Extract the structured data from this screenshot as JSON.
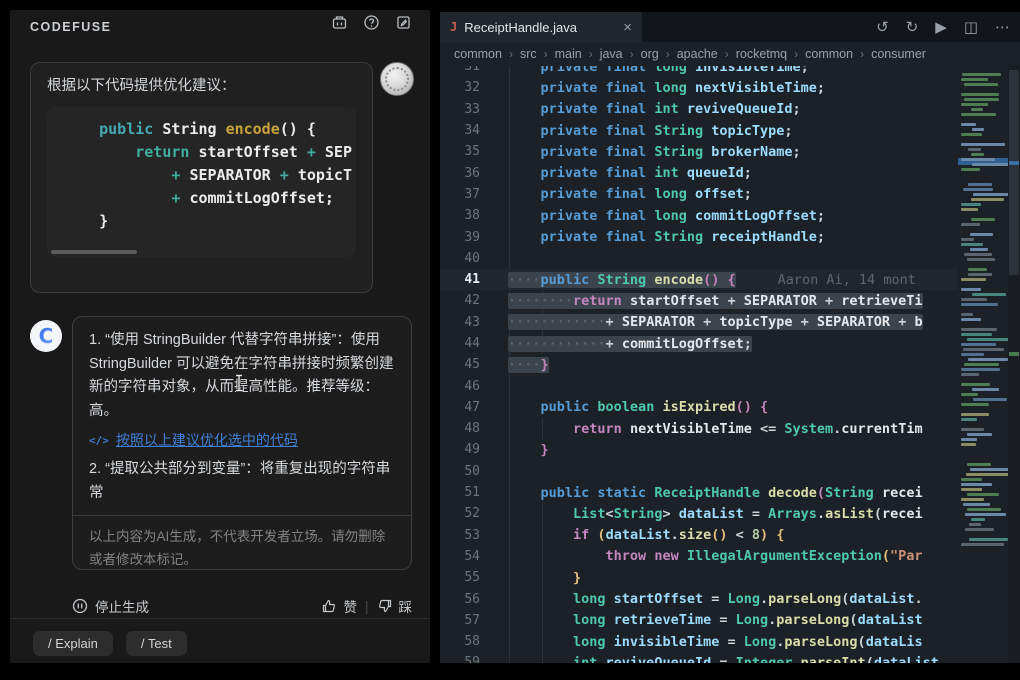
{
  "app": {
    "panel_title": "CODEFUSE"
  },
  "colors": {
    "panel_bg": "#191919",
    "editor_bg": "#1B2126",
    "selection": "#3B434D",
    "accent_link": "#3F7FD6",
    "keyword": "#569CD6",
    "type": "#4EC9B0",
    "method": "#DCDCAA",
    "control": "#C586C0",
    "string": "#CE9178",
    "number": "#B5CEA8",
    "field": "#9CDCFE",
    "chat_code_keyword": "#45A9B4",
    "chat_code_func": "#C9A43B",
    "minimap_selection": "#2F5F93"
  },
  "chat": {
    "user": {
      "prompt": "根据以下代码提供优化建议：",
      "code_lines": [
        [
          [
            "ccpl",
            "    "
          ],
          [
            "cck",
            "public "
          ],
          [
            "ccp",
            "String "
          ],
          [
            "ccf",
            "encode"
          ],
          [
            "ccp",
            "() {"
          ]
        ],
        [
          [
            "ccpl",
            "        "
          ],
          [
            "cco",
            "return "
          ],
          [
            "ccp",
            "startOffset "
          ],
          [
            "cco",
            "+ "
          ],
          [
            "ccp",
            "SEP"
          ]
        ],
        [
          [
            "ccpl",
            "            "
          ],
          [
            "cco",
            "+ "
          ],
          [
            "ccp",
            "SEPARATOR "
          ],
          [
            "cco",
            "+ "
          ],
          [
            "ccp",
            "topicT"
          ]
        ],
        [
          [
            "ccpl",
            "            "
          ],
          [
            "cco",
            "+ "
          ],
          [
            "ccp",
            "commitLogOffset;"
          ]
        ],
        [
          [
            "ccpl",
            "    "
          ],
          [
            "ccp",
            "}"
          ]
        ]
      ]
    },
    "assistant": {
      "para1": "1. “使用 StringBuilder 代替字符串拼接”：使用 StringBuilder 可以避免在字符串拼接时频繁创建新的字符串对象，从而提高性能。推荐等级：高。",
      "action_icon": "</>",
      "action_link": "按照以上建议优化选中的代码",
      "para2": "2. “提取公共部分到变量”：将重复出现的字符串常",
      "disclaimer": "以上内容为AI生成，不代表开发者立场。请勿删除或者修改本标记。"
    },
    "stop_label": "停止生成",
    "like_label": "赞",
    "dislike_label": "踩",
    "feedback_sep": "|",
    "quick_actions": [
      "/ Explain",
      "/ Test"
    ]
  },
  "editor": {
    "tab": {
      "filename": "ReceiptHandle.java",
      "close_glyph": "×",
      "file_icon": "J"
    },
    "action_icons": [
      {
        "name": "undo-icon",
        "glyph": "↺"
      },
      {
        "name": "redo-icon",
        "glyph": "↻"
      },
      {
        "name": "run-icon",
        "glyph": "▶"
      },
      {
        "name": "split-editor-icon",
        "glyph": "◫"
      },
      {
        "name": "more-actions-icon",
        "glyph": "⋯"
      }
    ],
    "breadcrumb": [
      "common",
      "src",
      "main",
      "java",
      "org",
      "apache",
      "rocketmq",
      "common",
      "consumer"
    ],
    "breadcrumb_sep": "›",
    "blame": "Aaron Ai, 14 mont",
    "lines": [
      {
        "n": 31,
        "segs": [
          [
            "pln",
            "    "
          ],
          [
            "kw",
            "private final "
          ],
          [
            "ty",
            "long "
          ],
          [
            "fld",
            "invisibleTime"
          ],
          [
            "pln",
            ";"
          ]
        ]
      },
      {
        "n": 32,
        "segs": [
          [
            "pln",
            "    "
          ],
          [
            "kw",
            "private final "
          ],
          [
            "ty",
            "long "
          ],
          [
            "fld",
            "nextVisibleTime"
          ],
          [
            "pln",
            ";"
          ]
        ]
      },
      {
        "n": 33,
        "segs": [
          [
            "pln",
            "    "
          ],
          [
            "kw",
            "private final "
          ],
          [
            "ty",
            "int "
          ],
          [
            "fld",
            "reviveQueueId"
          ],
          [
            "pln",
            ";"
          ]
        ]
      },
      {
        "n": 34,
        "segs": [
          [
            "pln",
            "    "
          ],
          [
            "kw",
            "private final "
          ],
          [
            "ty",
            "String "
          ],
          [
            "fld",
            "topicType"
          ],
          [
            "pln",
            ";"
          ]
        ]
      },
      {
        "n": 35,
        "segs": [
          [
            "pln",
            "    "
          ],
          [
            "kw",
            "private final "
          ],
          [
            "ty",
            "String "
          ],
          [
            "fld",
            "brokerName"
          ],
          [
            "pln",
            ";"
          ]
        ]
      },
      {
        "n": 36,
        "segs": [
          [
            "pln",
            "    "
          ],
          [
            "kw",
            "private final "
          ],
          [
            "ty",
            "int "
          ],
          [
            "fld",
            "queueId"
          ],
          [
            "pln",
            ";"
          ]
        ]
      },
      {
        "n": 37,
        "segs": [
          [
            "pln",
            "    "
          ],
          [
            "kw",
            "private final "
          ],
          [
            "ty",
            "long "
          ],
          [
            "fld",
            "offset"
          ],
          [
            "pln",
            ";"
          ]
        ]
      },
      {
        "n": 38,
        "segs": [
          [
            "pln",
            "    "
          ],
          [
            "kw",
            "private final "
          ],
          [
            "ty",
            "long "
          ],
          [
            "fld",
            "commitLogOffset"
          ],
          [
            "pln",
            ";"
          ]
        ]
      },
      {
        "n": 39,
        "segs": [
          [
            "pln",
            "    "
          ],
          [
            "kw",
            "private final "
          ],
          [
            "ty",
            "String "
          ],
          [
            "fld",
            "receiptHandle"
          ],
          [
            "pln",
            ";"
          ]
        ]
      },
      {
        "n": 40,
        "segs": []
      },
      {
        "n": 41,
        "cur": true,
        "sel": true,
        "blame": "Aaron Ai, 14 mont",
        "segs": [
          [
            "dot",
            "····"
          ],
          [
            "kw",
            "public "
          ],
          [
            "ty",
            "String "
          ],
          [
            "mth",
            "encode"
          ],
          [
            "br1",
            "()"
          ],
          [
            "pln",
            " "
          ],
          [
            "br1",
            "{"
          ]
        ]
      },
      {
        "n": 42,
        "sel": true,
        "segs": [
          [
            "dot",
            "········"
          ],
          [
            "ctl",
            "return "
          ],
          [
            "wht",
            "startOffset"
          ],
          [
            "pln",
            " + "
          ],
          [
            "wht",
            "SEPARATOR"
          ],
          [
            "pln",
            " + "
          ],
          [
            "wht",
            "retrieveTi"
          ]
        ]
      },
      {
        "n": 43,
        "sel": true,
        "segs": [
          [
            "dot",
            "············"
          ],
          [
            "pln",
            "+ "
          ],
          [
            "wht",
            "SEPARATOR"
          ],
          [
            "pln",
            " + "
          ],
          [
            "wht",
            "topicType"
          ],
          [
            "pln",
            " + "
          ],
          [
            "wht",
            "SEPARATOR"
          ],
          [
            "pln",
            " + "
          ],
          [
            "wht",
            "b"
          ]
        ]
      },
      {
        "n": 44,
        "sel": true,
        "segs": [
          [
            "dot",
            "············"
          ],
          [
            "pln",
            "+ "
          ],
          [
            "wht",
            "commitLogOffset"
          ],
          [
            "pln",
            ";"
          ]
        ]
      },
      {
        "n": 45,
        "sel": true,
        "segs": [
          [
            "dot",
            "····"
          ],
          [
            "br1",
            "}"
          ]
        ]
      },
      {
        "n": 46,
        "segs": []
      },
      {
        "n": 47,
        "segs": [
          [
            "pln",
            "    "
          ],
          [
            "kw",
            "public "
          ],
          [
            "ty",
            "boolean "
          ],
          [
            "mth",
            "isExpired"
          ],
          [
            "br1",
            "()"
          ],
          [
            "pln",
            " "
          ],
          [
            "br1",
            "{"
          ]
        ]
      },
      {
        "n": 48,
        "segs": [
          [
            "pln",
            "        "
          ],
          [
            "ctl",
            "return "
          ],
          [
            "wht",
            "nextVisibleTime"
          ],
          [
            "pln",
            " <= "
          ],
          [
            "ty",
            "System"
          ],
          [
            "pln",
            "."
          ],
          [
            "wht",
            "currentTim"
          ]
        ]
      },
      {
        "n": 49,
        "segs": [
          [
            "pln",
            "    "
          ],
          [
            "br1",
            "}"
          ]
        ]
      },
      {
        "n": 50,
        "segs": []
      },
      {
        "n": 51,
        "segs": [
          [
            "pln",
            "    "
          ],
          [
            "kw",
            "public static "
          ],
          [
            "ty",
            "ReceiptHandle "
          ],
          [
            "mth",
            "decode"
          ],
          [
            "br1",
            "("
          ],
          [
            "ty",
            "String "
          ],
          [
            "wht",
            "recei"
          ]
        ]
      },
      {
        "n": 52,
        "segs": [
          [
            "pln",
            "        "
          ],
          [
            "ty",
            "List"
          ],
          [
            "pln",
            "<"
          ],
          [
            "ty",
            "String"
          ],
          [
            "pln",
            "> "
          ],
          [
            "fld",
            "dataList"
          ],
          [
            "pln",
            " = "
          ],
          [
            "ty",
            "Arrays"
          ],
          [
            "pln",
            "."
          ],
          [
            "mth",
            "asList"
          ],
          [
            "pln",
            "("
          ],
          [
            "wht",
            "recei"
          ]
        ]
      },
      {
        "n": 53,
        "segs": [
          [
            "pln",
            "        "
          ],
          [
            "ctl",
            "if "
          ],
          [
            "br2",
            "("
          ],
          [
            "fld",
            "dataList"
          ],
          [
            "pln",
            "."
          ],
          [
            "mth",
            "size"
          ],
          [
            "br2",
            "()"
          ],
          [
            "pln",
            " < "
          ],
          [
            "num-lit",
            "8"
          ],
          [
            "br2",
            ")"
          ],
          [
            "pln",
            " "
          ],
          [
            "br2",
            "{"
          ]
        ]
      },
      {
        "n": 54,
        "segs": [
          [
            "pln",
            "            "
          ],
          [
            "ctl",
            "throw new "
          ],
          [
            "ty",
            "IllegalArgumentException"
          ],
          [
            "br2",
            "("
          ],
          [
            "str",
            "\"Par"
          ]
        ]
      },
      {
        "n": 55,
        "segs": [
          [
            "pln",
            "        "
          ],
          [
            "br2",
            "}"
          ]
        ]
      },
      {
        "n": 56,
        "segs": [
          [
            "pln",
            "        "
          ],
          [
            "ty",
            "long "
          ],
          [
            "fld",
            "startOffset"
          ],
          [
            "pln",
            " = "
          ],
          [
            "ty",
            "Long"
          ],
          [
            "pln",
            "."
          ],
          [
            "mth",
            "parseLong"
          ],
          [
            "pln",
            "("
          ],
          [
            "fld",
            "dataList"
          ],
          [
            "pln",
            "."
          ]
        ]
      },
      {
        "n": 57,
        "segs": [
          [
            "pln",
            "        "
          ],
          [
            "ty",
            "long "
          ],
          [
            "fld",
            "retrieveTime"
          ],
          [
            "pln",
            " = "
          ],
          [
            "ty",
            "Long"
          ],
          [
            "pln",
            "."
          ],
          [
            "mth",
            "parseLong"
          ],
          [
            "pln",
            "("
          ],
          [
            "fld",
            "dataList"
          ]
        ]
      },
      {
        "n": 58,
        "segs": [
          [
            "pln",
            "        "
          ],
          [
            "ty",
            "long "
          ],
          [
            "fld",
            "invisibleTime"
          ],
          [
            "pln",
            " = "
          ],
          [
            "ty",
            "Long"
          ],
          [
            "pln",
            "."
          ],
          [
            "mth",
            "parseLong"
          ],
          [
            "pln",
            "("
          ],
          [
            "fld",
            "dataLis"
          ]
        ]
      },
      {
        "n": 59,
        "segs": [
          [
            "pln",
            "        "
          ],
          [
            "ty",
            "int "
          ],
          [
            "fld",
            "reviveQueueId"
          ],
          [
            "pln",
            " = "
          ],
          [
            "ty",
            "Integer"
          ],
          [
            "pln",
            "."
          ],
          [
            "mth",
            "parseInt"
          ],
          [
            "pln",
            "("
          ],
          [
            "fld",
            "dataList"
          ]
        ]
      }
    ]
  }
}
